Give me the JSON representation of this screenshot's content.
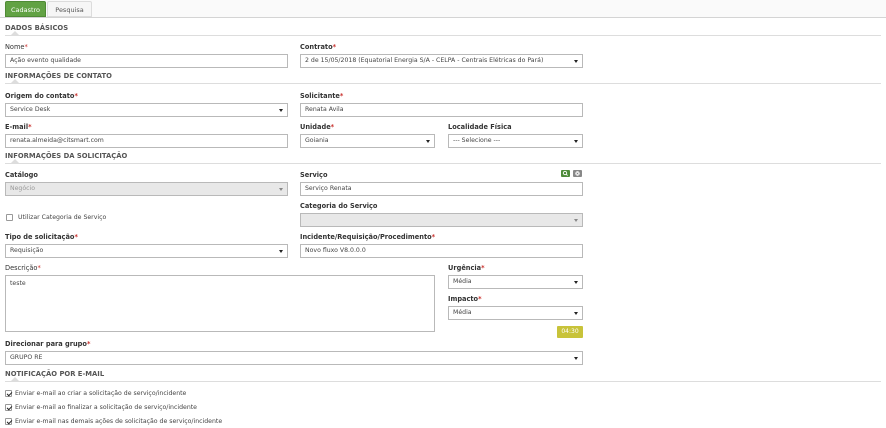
{
  "tabs": {
    "cadastro": "Cadastro",
    "pesquisa": "Pesquisa"
  },
  "sections": {
    "dados_basicos": "DADOS BÁSICOS",
    "contato": "INFORMAÇÕES DE CONTATO",
    "solicitacao": "INFORMAÇÕES DA SOLICITAÇÃO",
    "notificacao": "NOTIFICAÇÃO POR E-MAIL"
  },
  "required_mark": "*",
  "fields": {
    "nome": {
      "label": "Nome",
      "value": "Ação evento qualidade"
    },
    "contrato": {
      "label": "Contrato",
      "value": "2 de 15/05/2018 (Equatorial Energia S/A - CELPA - Centrais Elétricas do Pará)"
    },
    "origem": {
      "label": "Origem do contato",
      "value": "Service Desk"
    },
    "solicitante": {
      "label": "Solicitante",
      "value": "Renata Avila"
    },
    "email": {
      "label": "E-mail",
      "value": "renata.almeida@citsmart.com"
    },
    "unidade": {
      "label": "Unidade",
      "value": "Goiania"
    },
    "localidade": {
      "label": "Localidade Física",
      "value": "--- Selecione ---"
    },
    "catalogo": {
      "label": "Catálogo",
      "value": "Negócio"
    },
    "servico": {
      "label": "Serviço",
      "value": "Serviço Renata"
    },
    "utilizar_categoria": {
      "label": "Utilizar Categoria de Serviço",
      "checked": false
    },
    "categoria": {
      "label": "Categoria do Serviço",
      "value": ""
    },
    "tipo": {
      "label": "Tipo de solicitação",
      "value": "Requisição"
    },
    "incidente": {
      "label": "Incidente/Requisição/Procedimento",
      "value": "Novo fluxo V8.0.0.0"
    },
    "descricao": {
      "label": "Descrição",
      "value": "teste"
    },
    "urgencia": {
      "label": "Urgência",
      "value": "Média"
    },
    "impacto": {
      "label": "Impacto",
      "value": "Média"
    },
    "prazo": "04:30",
    "grupo": {
      "label": "Direcionar para grupo",
      "value": "GRUPO RE"
    }
  },
  "notifications": [
    {
      "label": "Enviar e-mail ao criar a solicitação de serviço/incidente",
      "checked": true
    },
    {
      "label": "Enviar e-mail ao finalizar a solicitação de serviço/incidente",
      "checked": true
    },
    {
      "label": "Enviar e-mail nas demais ações de solicitação de serviço/incidente",
      "checked": true
    }
  ],
  "colors": {
    "tab_active": "#62a244",
    "required": "#c9302c",
    "search_button": "#4e8b3a",
    "clear_button": "#888888",
    "time_badge": "#c8c33a"
  },
  "icons": {
    "search": "search-icon",
    "clear": "clear-icon"
  }
}
